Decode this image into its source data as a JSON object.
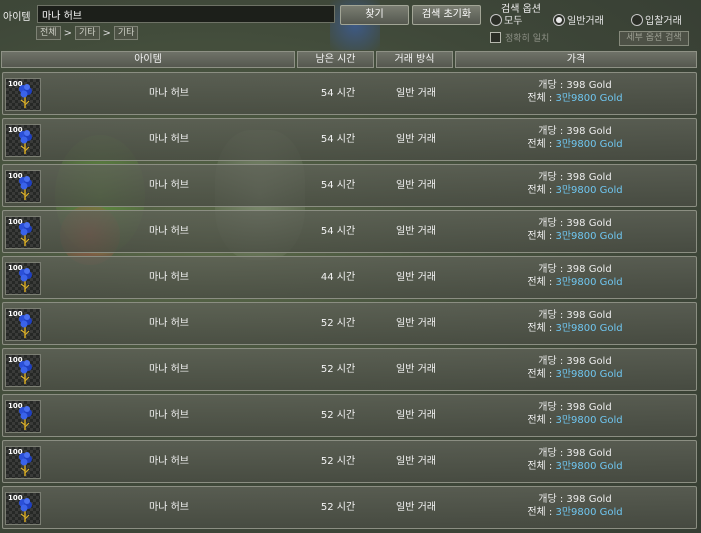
{
  "search": {
    "label": "아이템",
    "value": "마나 허브",
    "find_button": "찾기",
    "reset_button": "검색 초기화"
  },
  "breadcrumb": [
    "전체",
    "기타",
    "기타"
  ],
  "breadcrumb_sep": ">",
  "search_options": {
    "title": "검색 옵션",
    "radios": [
      {
        "label": "모두",
        "selected": false
      },
      {
        "label": "일반거래",
        "selected": true
      },
      {
        "label": "입찰거래",
        "selected": false
      }
    ],
    "exact_match_label": "정확히 일치",
    "detail_button": "세부 옵션 검색"
  },
  "table": {
    "headers": {
      "item": "아이템",
      "time": "남은 시간",
      "mode": "거래 방식",
      "price": "가격"
    },
    "rows": [
      {
        "qty": "100",
        "name": "마나 허브",
        "time": "54 시간",
        "mode": "일반 거래",
        "unit_price": "개당 : 398 Gold",
        "total_label": "전체 : ",
        "total_value": "3만9800 Gold"
      },
      {
        "qty": "100",
        "name": "마나 허브",
        "time": "54 시간",
        "mode": "일반 거래",
        "unit_price": "개당 : 398 Gold",
        "total_label": "전체 : ",
        "total_value": "3만9800 Gold"
      },
      {
        "qty": "100",
        "name": "마나 허브",
        "time": "54 시간",
        "mode": "일반 거래",
        "unit_price": "개당 : 398 Gold",
        "total_label": "전체 : ",
        "total_value": "3만9800 Gold"
      },
      {
        "qty": "100",
        "name": "마나 허브",
        "time": "54 시간",
        "mode": "일반 거래",
        "unit_price": "개당 : 398 Gold",
        "total_label": "전체 : ",
        "total_value": "3만9800 Gold"
      },
      {
        "qty": "100",
        "name": "마나 허브",
        "time": "44 시간",
        "mode": "일반 거래",
        "unit_price": "개당 : 398 Gold",
        "total_label": "전체 : ",
        "total_value": "3만9800 Gold"
      },
      {
        "qty": "100",
        "name": "마나 허브",
        "time": "52 시간",
        "mode": "일반 거래",
        "unit_price": "개당 : 398 Gold",
        "total_label": "전체 : ",
        "total_value": "3만9800 Gold"
      },
      {
        "qty": "100",
        "name": "마나 허브",
        "time": "52 시간",
        "mode": "일반 거래",
        "unit_price": "개당 : 398 Gold",
        "total_label": "전체 : ",
        "total_value": "3만9800 Gold"
      },
      {
        "qty": "100",
        "name": "마나 허브",
        "time": "52 시간",
        "mode": "일반 거래",
        "unit_price": "개당 : 398 Gold",
        "total_label": "전체 : ",
        "total_value": "3만9800 Gold"
      },
      {
        "qty": "100",
        "name": "마나 허브",
        "time": "52 시간",
        "mode": "일반 거래",
        "unit_price": "개당 : 398 Gold",
        "total_label": "전체 : ",
        "total_value": "3만9800 Gold"
      },
      {
        "qty": "100",
        "name": "마나 허브",
        "time": "52 시간",
        "mode": "일반 거래",
        "unit_price": "개당 : 398 Gold",
        "total_label": "전체 : ",
        "total_value": "3만9800 Gold"
      }
    ]
  },
  "colors": {
    "total_value": "#6fc6f0",
    "row_bg": "#5a5d54",
    "herb_icon": "#2a4fd8"
  },
  "icons": {
    "item": "mana-herb-icon"
  }
}
